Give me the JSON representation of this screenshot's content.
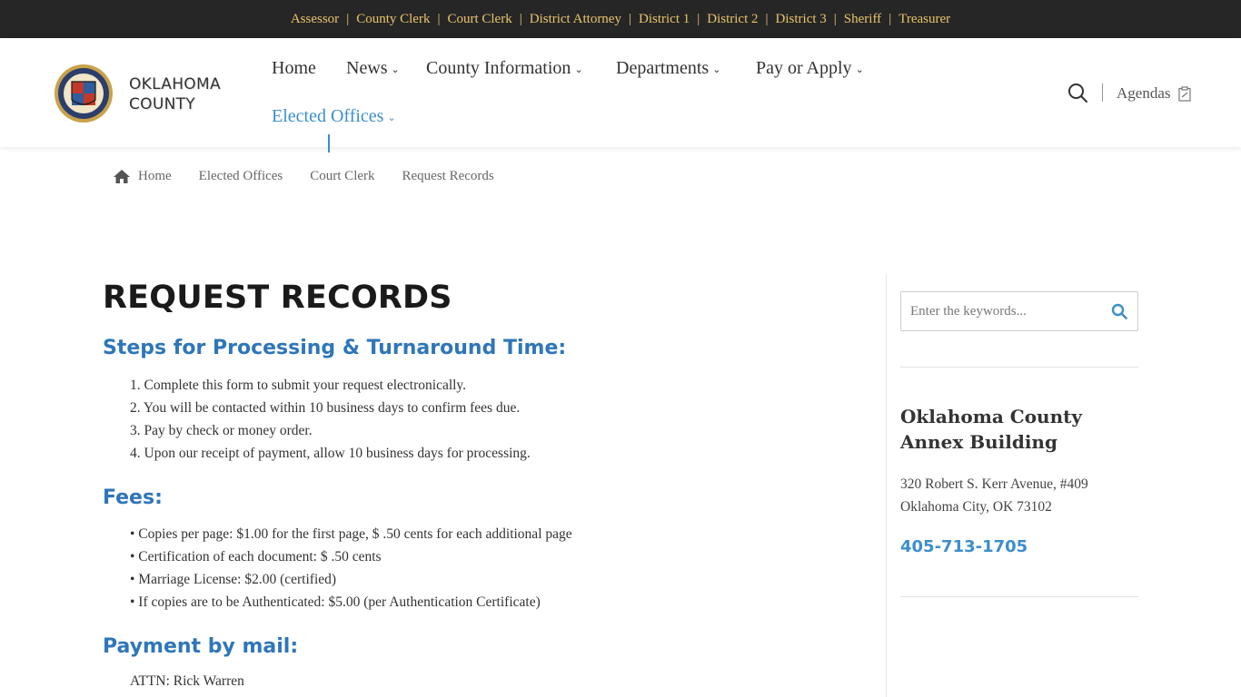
{
  "topbar": {
    "links": [
      "Assessor",
      "County Clerk",
      "Court Clerk",
      "District Attorney",
      "District 1",
      "District 2",
      "District 3",
      "Sheriff",
      "Treasurer"
    ],
    "separator": "|"
  },
  "header": {
    "logo_line1": "OKLAHOMA",
    "logo_line2": "COUNTY",
    "nav": {
      "home": "Home",
      "news": "News",
      "county_information": "County Information",
      "departments": "Departments",
      "pay_or_apply": "Pay or Apply",
      "elected_offices": "Elected Offices"
    },
    "agendas": "Agendas",
    "colors": {
      "accent": "#3c8ecb",
      "topbar_bg": "#262626",
      "topbar_link": "#e9c46a"
    }
  },
  "breadcrumb": {
    "items": [
      "Home",
      "Elected Offices",
      "Court Clerk",
      "Request Records"
    ]
  },
  "main": {
    "title": "REQUEST RECORDS",
    "steps_heading": "Steps for Processing & Turnaround Time:",
    "steps": [
      "1. Complete this form to submit your request electronically.",
      "2. You will be contacted within 10 business days to confirm fees due.",
      "3. Pay by check or money order.",
      "4. Upon our receipt of payment, allow 10 business days for processing."
    ],
    "fees_heading": "Fees:",
    "fees": [
      "• Copies per page: $1.00 for the first page, $ .50 cents for each additional page",
      "• Certification of each document: $ .50 cents",
      "• Marriage License: $2.00 (certified)",
      "• If copies are to be Authenticated: $5.00 (per Authentication Certificate)"
    ],
    "payment_heading": "Payment by mail:",
    "attn": "ATTN: Rick Warren",
    "heading_color": "#2f76b9"
  },
  "sidebar": {
    "search_placeholder": "Enter the keywords...",
    "building_title": "Oklahoma County Annex Building",
    "address_line1": "320 Robert S. Kerr Avenue, #409",
    "address_line2": "Oklahoma City, OK 73102",
    "phone": "405-713-1705"
  }
}
